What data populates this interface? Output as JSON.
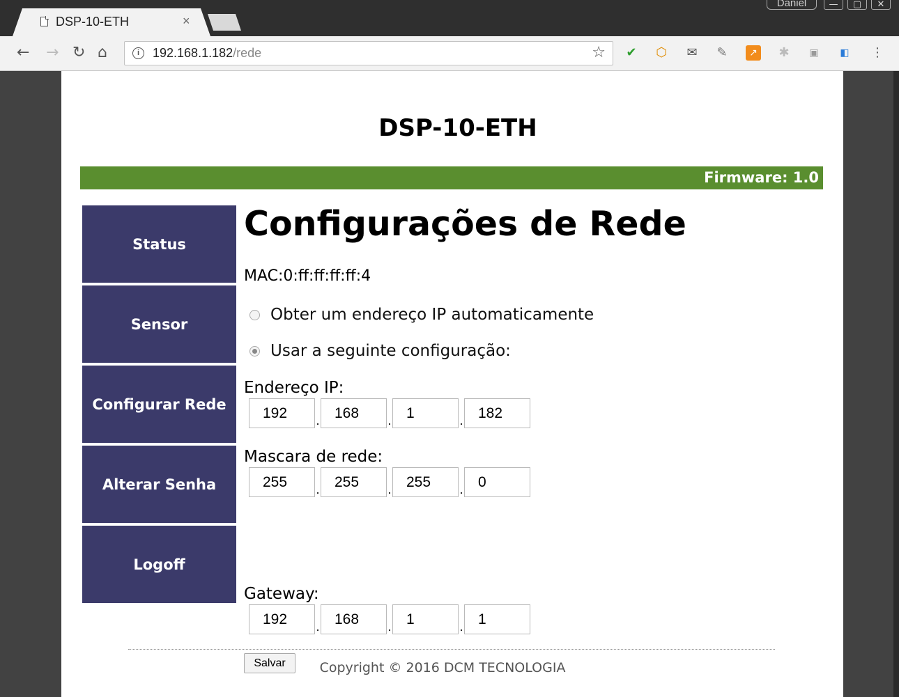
{
  "browser": {
    "tab_title": "DSP-10-ETH",
    "tab_close": "×",
    "user_name": "Daniel",
    "url_host": "192.168.1.182",
    "url_path": "/rede"
  },
  "page": {
    "device_title": "DSP-10-ETH",
    "firmware": "Firmware: 1.0",
    "accent_green": "#5a8e2f",
    "menu_color": "#3b3a6a",
    "menu": [
      "Status",
      "Sensor",
      "Configurar Rede",
      "Alterar Senha",
      "Logoff"
    ],
    "heading": "Configurações de Rede",
    "mac": "MAC:0:ff:ff:ff:ff:4",
    "radio_auto": "Obter um endereço IP automaticamente",
    "radio_manual": "Usar a seguinte configuração:",
    "radio_selected": "manual",
    "ip_label": "Endereço IP:",
    "ip": [
      "192",
      "168",
      "1",
      "182"
    ],
    "mask_label": "Mascara de rede:",
    "mask": [
      "255",
      "255",
      "255",
      "0"
    ],
    "gateway_label": "Gateway:",
    "gateway": [
      "192",
      "168",
      "1",
      "1"
    ],
    "save_label": "Salvar",
    "copyright": "Copyright © 2016 DCM TECNOLOGIA"
  }
}
